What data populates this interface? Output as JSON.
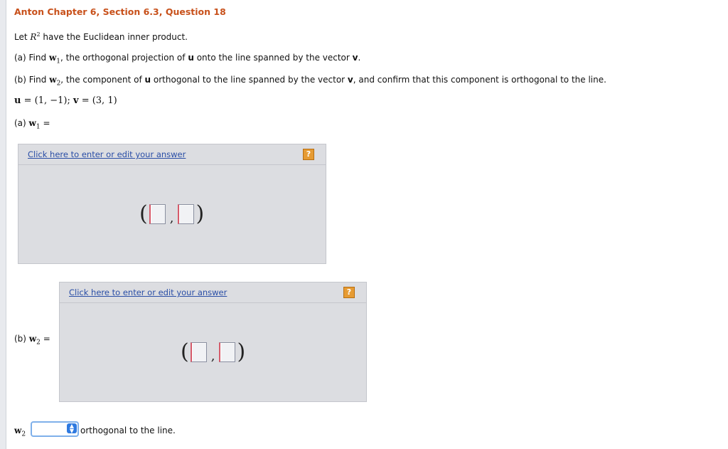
{
  "title": "Anton Chapter 6, Section 6.3, Question 18",
  "intro": {
    "prefix": "Let",
    "space": "R",
    "exp": "2",
    "suffix": "have the Euclidean inner product."
  },
  "part_a": {
    "label": "(a) Find",
    "w": "w",
    "sub": "1",
    "text1": ", the orthogonal projection of",
    "u": "u",
    "text2": "onto the line spanned by the vector",
    "v": "v",
    "end": "."
  },
  "part_b": {
    "label": "(b) Find",
    "w": "w",
    "sub": "2",
    "text1": ", the component of",
    "u": "u",
    "text2": "orthogonal to the line spanned by the vector",
    "v": "v",
    "text3": ", and confirm that this component is orthogonal to the line."
  },
  "given": {
    "u": "u",
    "u_val": "= (1, −1); ",
    "v": "v",
    "v_val": "= (3, 1)"
  },
  "answer_a": {
    "label": "(a)",
    "w": "w",
    "sub": "1",
    "eq": "=",
    "link": "Click here to enter or edit your answer",
    "help": "?",
    "open": "(",
    "comma": ",",
    "close": ")"
  },
  "answer_b": {
    "label": "(b)",
    "w": "w",
    "sub": "2",
    "eq": "=",
    "link": "Click here to enter or edit your answer",
    "help": "?",
    "open": "(",
    "comma": ",",
    "close": ")"
  },
  "final": {
    "w": "w",
    "sub": "2",
    "select_value": "",
    "text": "orthogonal to the line."
  },
  "colors": {
    "title": "#c8511b",
    "link": "#2a4ea6",
    "panel": "#dcdde1",
    "help": "#e69b33"
  }
}
